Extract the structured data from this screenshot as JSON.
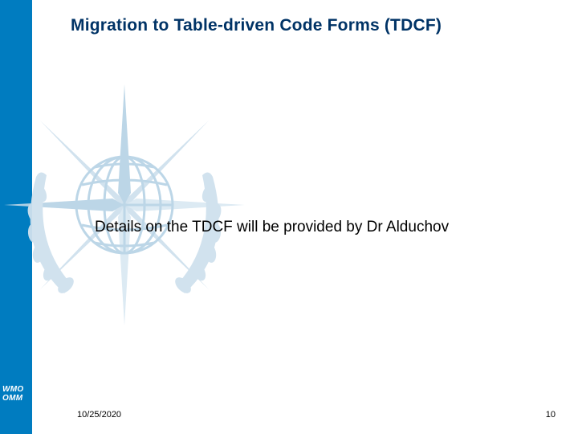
{
  "title": "Migration to Table-driven Code Forms (TDCF)",
  "body": "Details on the TDCF will be provided by Dr Alduchov",
  "footer": {
    "date": "10/25/2020",
    "page": "10"
  },
  "logo": {
    "line1": "WMO",
    "line2": "OMM"
  },
  "colors": {
    "accent": "#007cc0",
    "title": "#003366",
    "emblem": "#b9d4e6"
  }
}
